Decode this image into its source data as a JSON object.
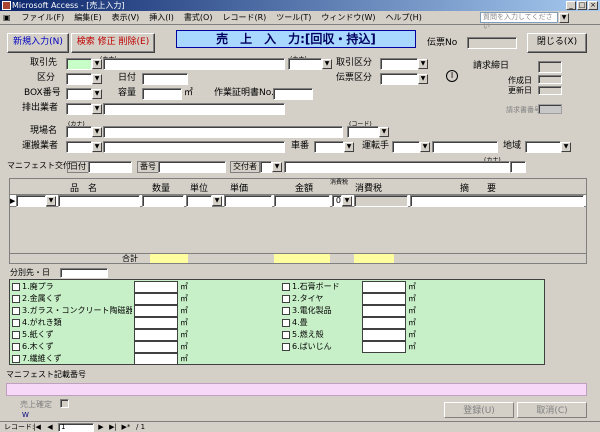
{
  "window": {
    "title": "Microsoft Access - [売上入力]",
    "ask_placeholder": "質問を入力してください"
  },
  "menu": [
    "ファイル(F)",
    "編集(E)",
    "表示(V)",
    "挿入(I)",
    "書式(O)",
    "レコード(R)",
    "ツール(T)",
    "ウィンドウ(W)",
    "ヘルプ(H)"
  ],
  "toolbar": {
    "new_input": "新規入力(N)",
    "search_edit_delete": "検索 修正 削除(E)",
    "form_title": "売　上　入　力:[回収・持込]",
    "voucher_label": "伝票No",
    "close": "閉じる(X)"
  },
  "header": {
    "kana_hint": "(カナ)",
    "kana_hint2": "(カナ)",
    "code_hint": "(コード)",
    "customer": "取引先",
    "category": "区分",
    "date": "日付",
    "box_no": "BOX番号",
    "capacity": "容量",
    "unit_m3": "㎥",
    "work_cert": "作業証明書No.",
    "discharger": "排出業者",
    "trade_category": "取引区分",
    "voucher_category": "伝票区分",
    "billing_close": "請求締日",
    "created": "作成日",
    "updated": "更新日",
    "billing_no": "請求書番号",
    "site_name": "現場名",
    "carrier": "運搬業者",
    "vehicle_no": "車番",
    "driver": "運転手",
    "region": "地域",
    "manifest_issue": "マニフェスト交付",
    "manifest_date": "日付",
    "manifest_no": "番号",
    "issuer": "交付者",
    "kana_hint3": "(カナ)"
  },
  "grid": {
    "columns": [
      "品　名",
      "数量",
      "単位",
      "単価",
      "金額",
      "消費税",
      "消費税",
      "摘　　要"
    ],
    "tax_default": "0",
    "row_marker": "▶",
    "total_label": "合計"
  },
  "classification": {
    "label": "分別先・日",
    "left_items": [
      "1.廃プラ",
      "2.金属くず",
      "3.ガラス・コンクリート陶磁器",
      "4.がれき類",
      "5.紙くず",
      "6.木くず",
      "7.繊維くず"
    ],
    "right_items": [
      "1.石膏ボード",
      "2.タイヤ",
      "3.電化製品",
      "4.畳",
      "5.燃え殻",
      "6.ばいじん"
    ],
    "unit": "㎥"
  },
  "manifest_note": "マニフェスト記載番号",
  "footer": {
    "update_done": "売上確定",
    "w_label": "W",
    "register": "登録(U)",
    "cancel": "取消(C)"
  },
  "navigation": {
    "label": "レコード:",
    "current": "1",
    "total": "/ 1"
  }
}
